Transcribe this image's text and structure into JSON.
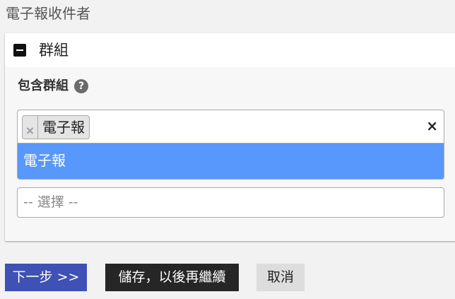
{
  "page": {
    "title": "電子報收件者"
  },
  "panel": {
    "title": "群組",
    "field_label": "包含群組",
    "help_glyph": "?",
    "selected_tags": [
      {
        "label": "電子報",
        "remove_glyph": "×"
      }
    ],
    "clear_glyph": "×",
    "dropdown_options": [
      {
        "label": "電子報",
        "highlighted": true
      }
    ],
    "choose_placeholder": "-- 選擇 --"
  },
  "buttons": {
    "next_label": "下一步 >>",
    "save_label": "儲存，以後再繼續",
    "cancel_label": "取消"
  },
  "colors": {
    "primary": "#3f51b5",
    "dark": "#262626",
    "highlight": "#5897fb"
  },
  "icons": {
    "collapse": "minus-square-icon",
    "help": "question-circle-icon",
    "clear": "close-icon",
    "remove": "close-icon"
  }
}
